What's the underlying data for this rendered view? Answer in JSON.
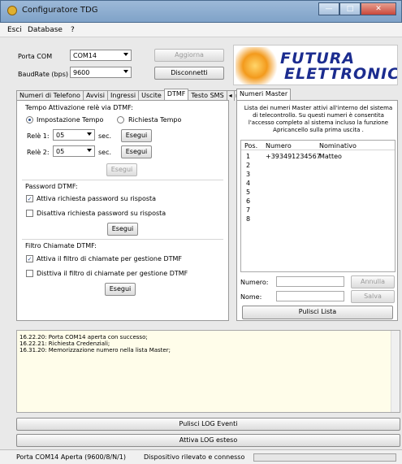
{
  "window": {
    "title": "Configuratore TDG"
  },
  "menu": {
    "items": [
      "Esci",
      "Database",
      "?"
    ]
  },
  "connection": {
    "port_label": "Porta COM",
    "port_value": "COM14",
    "baud_label": "BaudRate (bps)",
    "baud_value": "9600",
    "update_button": "Aggiorna",
    "disconnect_button": "Disconnetti"
  },
  "logo": {
    "line1": "FUTURA",
    "line2": "ELETTRONICA"
  },
  "left_tabs": [
    "Numeri di Telefono",
    "Avvisi",
    "Ingressi",
    "Uscite",
    "DTMF",
    "Testo SMS"
  ],
  "left_tabs_active": "DTMF",
  "dtmf": {
    "activation_group": "Tempo Attivazione relè via DTMF:",
    "radio_time": "Impostazione Tempo",
    "radio_request": "Richiesta Tempo",
    "relay1_label": "Relè 1:",
    "relay1_value": "05",
    "relay2_label": "Relè 2:",
    "relay2_value": "05",
    "sec": "sec.",
    "execute": "Esegui",
    "password_group": "Password DTMF:",
    "pw_enable": "Attiva richiesta password su risposta",
    "pw_disable": "Disattiva richiesta password su risposta",
    "filter_group": "Filtro Chiamate DTMF:",
    "filter_enable": "Attiva il filtro di chiamate per gestione DTMF",
    "filter_disable": "Disttiva il filtro di chiamate per gestione DTMF"
  },
  "master": {
    "tab": "Numeri Master",
    "description": "Lista dei numeri Master attivi all'interno del sistema di telecontrollo. Su questi numeri è consentita l'accesso completo al sistema incluso la funzione Apricancello sulla prima uscita .",
    "columns": [
      "Pos.",
      "Numero",
      "Nominativo"
    ],
    "rows": [
      {
        "pos": "1",
        "numero": "+393491234567",
        "nome": "Matteo"
      },
      {
        "pos": "2",
        "numero": "",
        "nome": ""
      },
      {
        "pos": "3",
        "numero": "",
        "nome": ""
      },
      {
        "pos": "4",
        "numero": "",
        "nome": ""
      },
      {
        "pos": "5",
        "numero": "",
        "nome": ""
      },
      {
        "pos": "6",
        "numero": "",
        "nome": ""
      },
      {
        "pos": "7",
        "numero": "",
        "nome": ""
      },
      {
        "pos": "8",
        "numero": "",
        "nome": ""
      }
    ],
    "number_label": "Numero:",
    "name_label": "Nome:",
    "cancel_button": "Annulla",
    "save_button": "Salva",
    "clear_button": "Pulisci Lista"
  },
  "log": {
    "lines": [
      "16.22.20: Porta COM14 aperta con successo;",
      "16.22.21: Richiesta Credenziali;",
      "16.31.20: Memorizzazione numero nella lista Master;"
    ],
    "clear_button": "Pulisci LOG Eventi",
    "extended_button": "Attiva LOG esteso"
  },
  "status": {
    "port": "Porta COM14 Aperta (9600/8/N/1)",
    "device": "Dispositivo rilevato e connesso"
  }
}
